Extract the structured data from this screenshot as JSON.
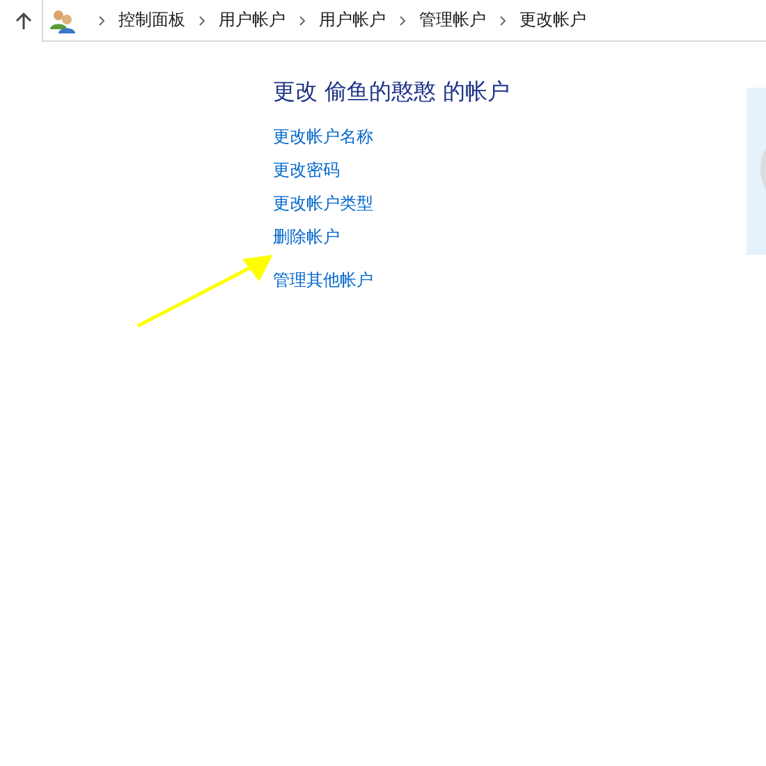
{
  "breadcrumb": [
    "控制面板",
    "用户帐户",
    "用户帐户",
    "管理帐户",
    "更改帐户"
  ],
  "title": "更改 偷鱼的憨憨 的帐户",
  "links": [
    "更改帐户名称",
    "更改密码",
    "更改帐户类型",
    "删除帐户",
    "管理其他帐户"
  ],
  "annotation": {
    "kind": "arrow"
  }
}
